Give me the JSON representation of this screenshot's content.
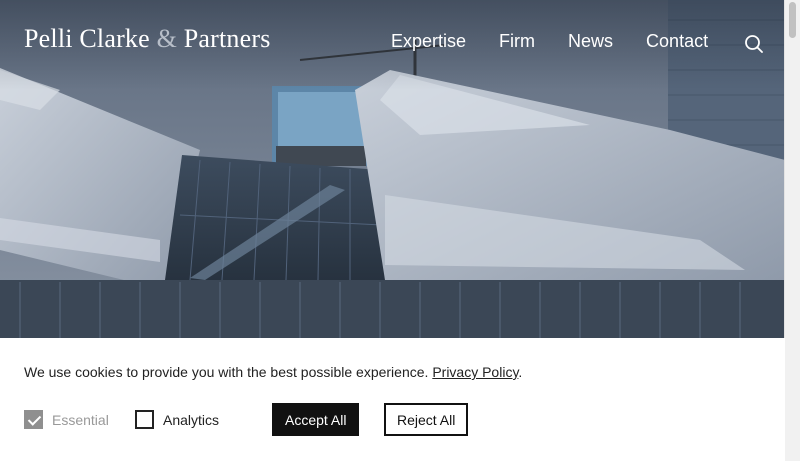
{
  "header": {
    "logo_part1": "Pelli Clarke ",
    "logo_amp": "&",
    "logo_part2": " Partners",
    "nav": [
      "Expertise",
      "Firm",
      "News",
      "Contact"
    ],
    "search_icon": "search-icon"
  },
  "cookie_banner": {
    "message": "We use cookies to provide you with the best possible experience. ",
    "policy_link": "Privacy Policy",
    "message_end": ".",
    "options": [
      {
        "label": "Essential",
        "checked": true,
        "disabled": true
      },
      {
        "label": "Analytics",
        "checked": false,
        "disabled": false
      }
    ],
    "accept_label": "Accept All",
    "reject_label": "Reject All"
  }
}
